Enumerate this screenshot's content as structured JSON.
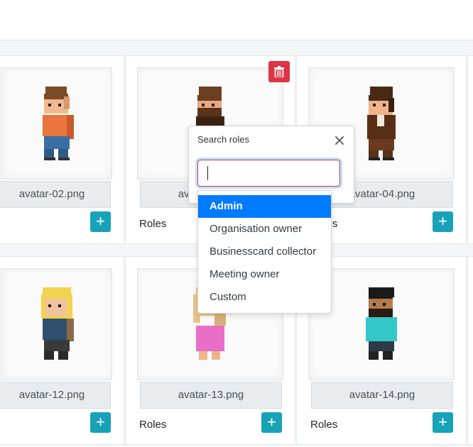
{
  "cards": [
    {
      "filename": "avatar-02.png",
      "roles_label": ""
    },
    {
      "filename": "avatar-03.png",
      "roles_label": "Roles"
    },
    {
      "filename": "avatar-04.png",
      "roles_label": "Roles"
    },
    {
      "filename": "avatar-12.png",
      "roles_label": ""
    },
    {
      "filename": "avatar-13.png",
      "roles_label": "Roles"
    },
    {
      "filename": "avatar-14.png",
      "roles_label": "Roles"
    }
  ],
  "add_label": "+",
  "popover": {
    "title": "Search roles",
    "input_value": "",
    "options": [
      "Admin",
      "Organisation owner",
      "Businesscard collector",
      "Meeting owner",
      "Custom"
    ],
    "selected_index": 0
  },
  "colors": {
    "accent": "#17a2b8",
    "danger": "#dc3545",
    "highlight": "#007bff"
  }
}
